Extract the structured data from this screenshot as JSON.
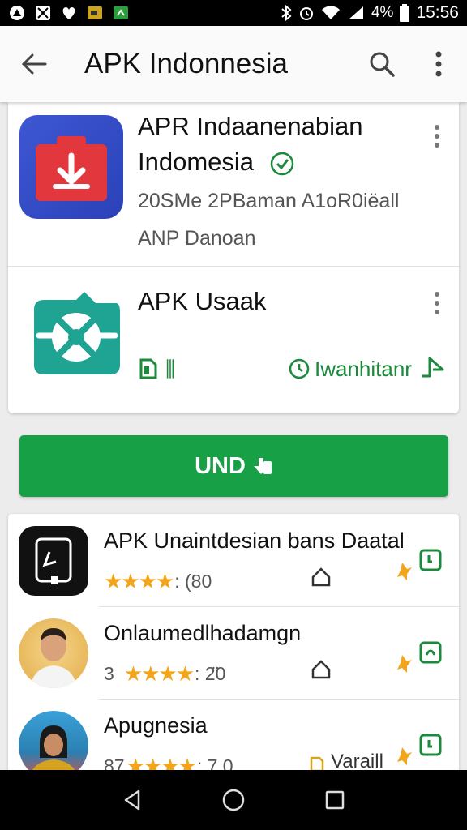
{
  "status_bar": {
    "battery": "4%",
    "time": "15:56"
  },
  "appbar": {
    "title": "APK Indonnesia"
  },
  "featured": {
    "app1": {
      "title_line1": "APR Indaanenabian",
      "title_line2": "Indomesia",
      "meta": "20SMe 2PBaman A1oR0iëall",
      "developer": "ANP Danoan"
    },
    "app2": {
      "title": "APK Usaak",
      "left_stat": "⫼",
      "right_link": "Iwanhitanr"
    }
  },
  "download_button": {
    "label": "UND"
  },
  "list": [
    {
      "name": "APK Unaintdesian bans Daatal",
      "prefix": "",
      "rating_text": ": (80",
      "mid_text": ""
    },
    {
      "name": "Onlaumedlhadamgn",
      "prefix": "3",
      "rating_text": ": 2̈0",
      "mid_text": ""
    },
    {
      "name": "Apugnesia",
      "prefix": "87",
      "rating_text": ": 7.0",
      "mid_text": "Varaill"
    }
  ],
  "colors": {
    "accent_green": "#17a046",
    "star": "#f2a51a",
    "app1_bg": "#3d57d3",
    "app1_inner": "#e2373d",
    "app2_bg": "#1fa392"
  },
  "icons": [
    "back-arrow-icon",
    "search-icon",
    "more-vert-icon",
    "download-icon",
    "nav-back-icon",
    "nav-home-icon",
    "nav-recents-icon"
  ]
}
